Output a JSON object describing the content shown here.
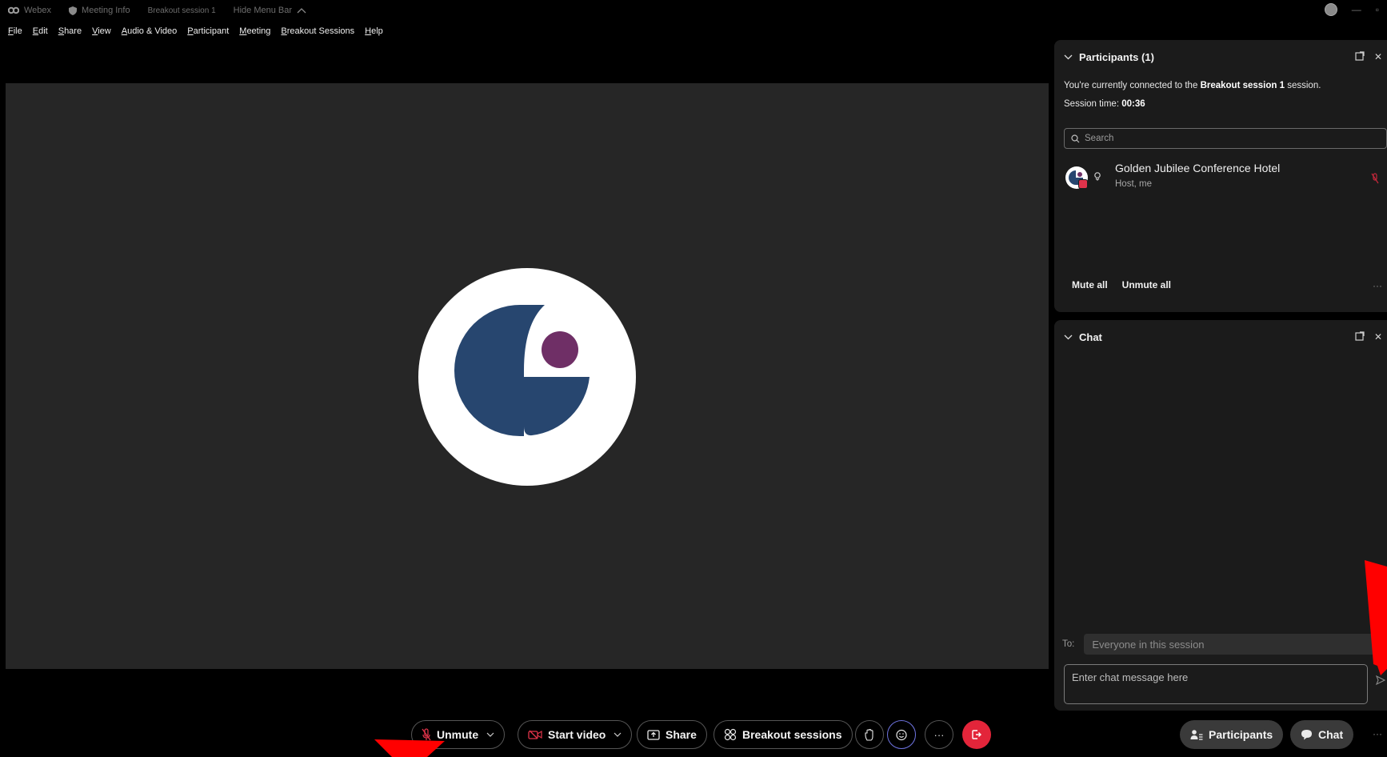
{
  "titlebar": {
    "app_name": "Webex",
    "meeting_info": "Meeting Info",
    "session_name": "Breakout session 1",
    "hide_menu_bar": "Hide Menu Bar"
  },
  "menubar": {
    "items": [
      "File",
      "Edit",
      "Share",
      "View",
      "Audio & Video",
      "Participant",
      "Meeting",
      "Breakout Sessions",
      "Help"
    ]
  },
  "participants_panel": {
    "title": "Participants (1)",
    "connected_prefix": "You're currently connected to the",
    "connected_session": "Breakout session 1",
    "connected_suffix": "session.",
    "session_time_label": "Session time:",
    "session_time_value": "00:36",
    "search_placeholder": "Search",
    "participants": [
      {
        "name": "Golden Jubilee Conference Hotel",
        "role": "Host, me"
      }
    ],
    "mute_all": "Mute all",
    "unmute_all": "Unmute all"
  },
  "chat_panel": {
    "title": "Chat",
    "to_label": "To:",
    "to_value": "Everyone in this session",
    "input_placeholder": "Enter chat message here"
  },
  "controls": {
    "unmute": "Unmute",
    "start_video": "Start video",
    "share": "Share",
    "breakout_sessions": "Breakout sessions",
    "participants": "Participants",
    "chat": "Chat"
  },
  "colors": {
    "logo_navy": "#27466f",
    "logo_purple": "#6f2f66",
    "end_red": "#e3253a",
    "annotation_red": "#ff0000"
  },
  "icons": [
    "webex-logo-icon",
    "shield-icon",
    "chevron-up-icon",
    "chevron-down-icon",
    "popout-icon",
    "close-icon",
    "search-icon",
    "mic-muted-icon",
    "video-off-icon",
    "share-icon",
    "breakout-icon",
    "raise-hand-icon",
    "reactions-icon",
    "more-icon",
    "leave-icon",
    "participants-icon",
    "chat-icon",
    "send-icon"
  ]
}
